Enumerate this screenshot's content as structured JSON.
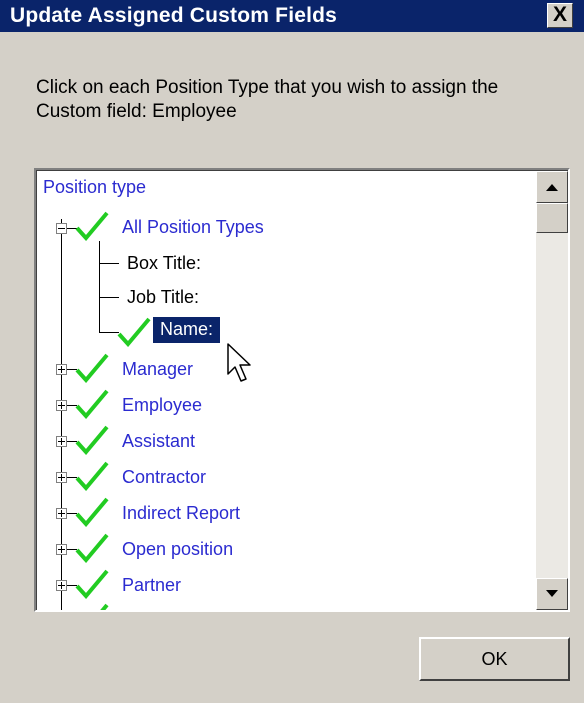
{
  "dialog": {
    "title": "Update Assigned Custom Fields",
    "close_label": "X",
    "instructions": "Click on each Position Type that you wish to assign the Custom field: Employee",
    "ok_label": "OK"
  },
  "tree": {
    "header": "Position type",
    "root": {
      "label": "All Position Types",
      "expanded": true,
      "checked": true,
      "children": [
        {
          "label": "Box Title:",
          "checked": false
        },
        {
          "label": "Job Title:",
          "checked": false
        },
        {
          "label": "Name:",
          "checked": true,
          "selected": true
        }
      ]
    },
    "items": [
      {
        "label": "Manager",
        "checked": true
      },
      {
        "label": "Employee",
        "checked": true
      },
      {
        "label": "Assistant",
        "checked": true
      },
      {
        "label": "Contractor",
        "checked": true
      },
      {
        "label": "Indirect Report",
        "checked": true
      },
      {
        "label": "Open position",
        "checked": true
      },
      {
        "label": "Partner",
        "checked": true
      }
    ]
  },
  "colors": {
    "titlebar": "#0a246a",
    "link_blue": "#2b2bd0",
    "check_green": "#22cc22",
    "window_bg": "#d4d0c8"
  }
}
